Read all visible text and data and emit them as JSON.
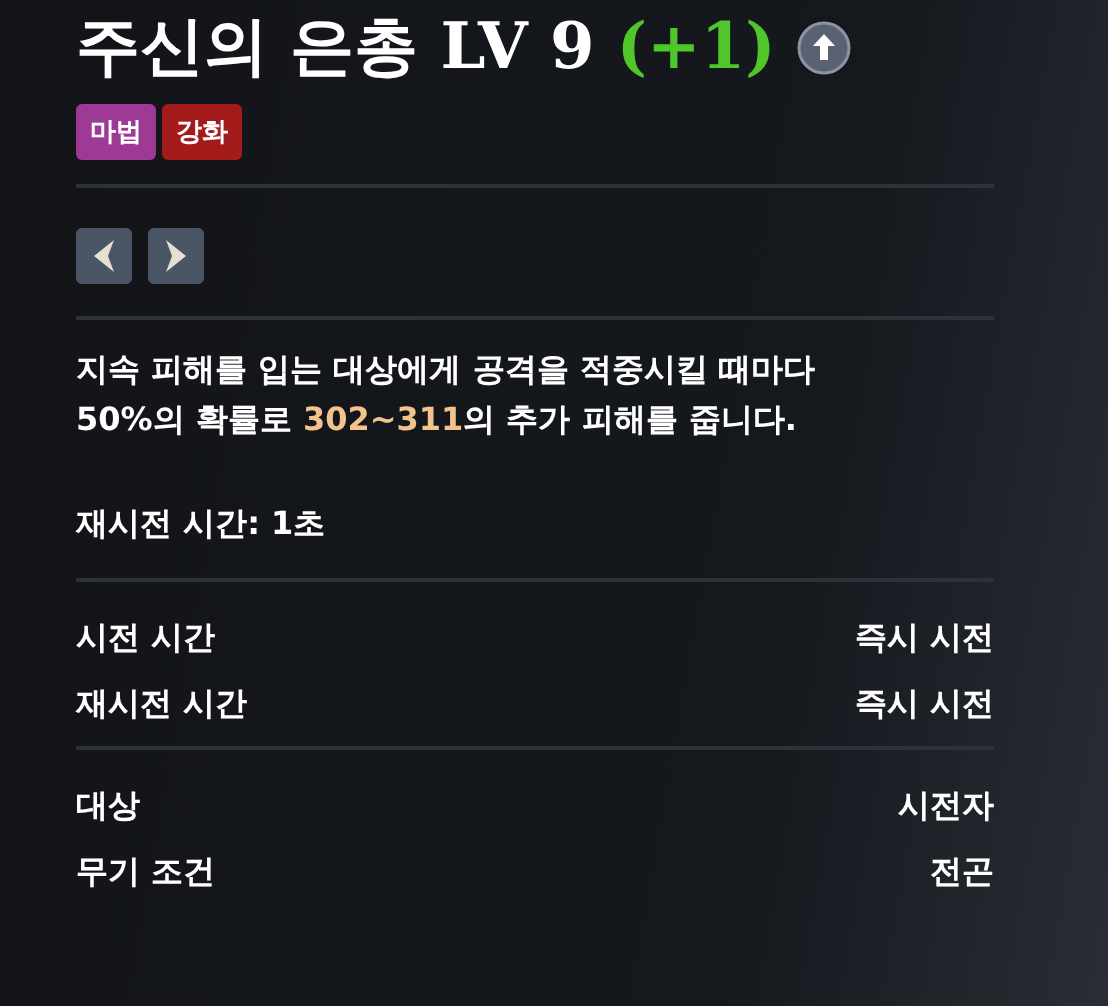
{
  "skill": {
    "name": "주신의 은총 LV 9",
    "bonus": "(+1)"
  },
  "tags": [
    {
      "label": "마법",
      "color": "#9c3a96"
    },
    {
      "label": "강화",
      "color": "#a31b1b"
    }
  ],
  "description": {
    "before": "지속 피해를 입는 대상에게 공격을 적중시킬 때마다\n50%의 확률로 ",
    "highlight": "302~311",
    "after": "의 추가 피해를 줍니다."
  },
  "cooldown_note": "재시전 시간: 1초",
  "stat_groups": [
    [
      {
        "label": "시전 시간",
        "value": "즉시 시전"
      },
      {
        "label": "재시전 시간",
        "value": "즉시 시전"
      }
    ],
    [
      {
        "label": "대상",
        "value": "시전자"
      },
      {
        "label": "무기 조건",
        "value": "전곤"
      }
    ]
  ]
}
